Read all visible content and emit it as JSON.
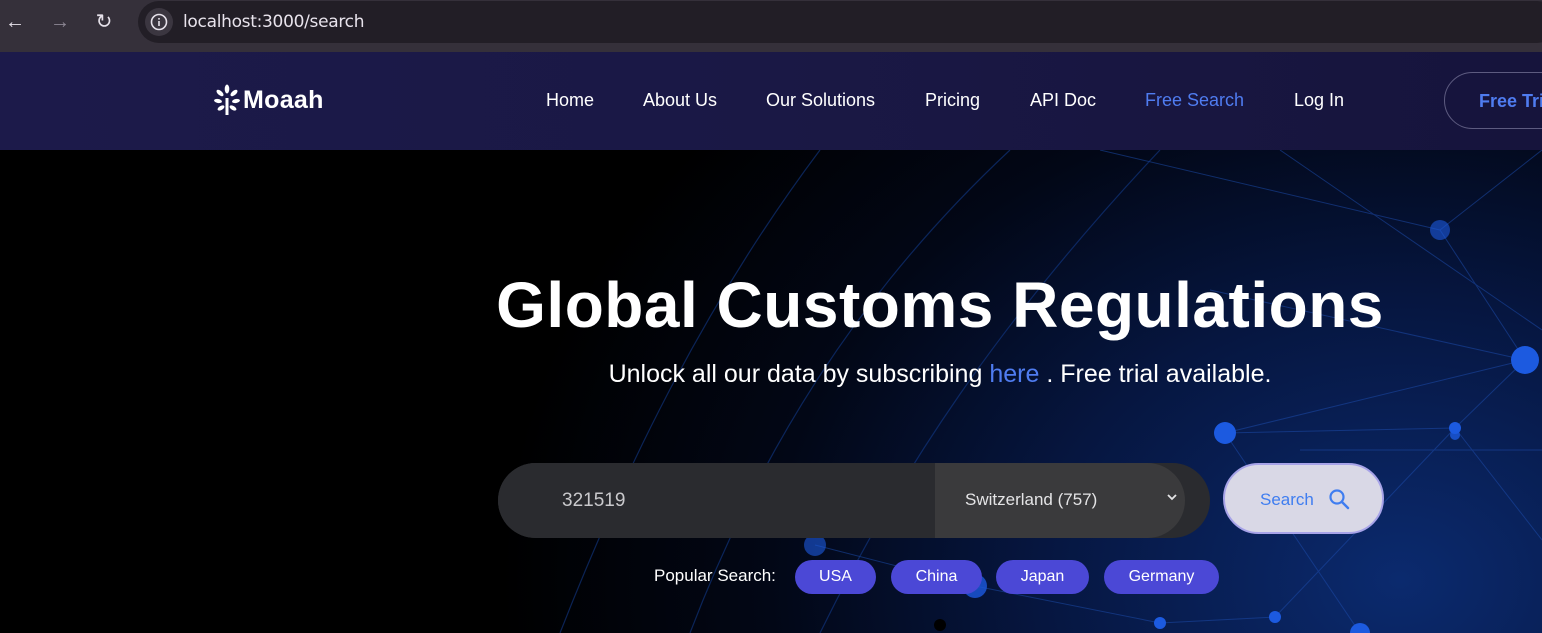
{
  "browser": {
    "url": "localhost:3000/search"
  },
  "header": {
    "brand": "Moaah",
    "nav": [
      "Home",
      "About Us",
      "Our Solutions",
      "Pricing",
      "API Doc",
      "Free Search",
      "Log In"
    ],
    "active_nav": "Free Search",
    "cta_label": "Free Tri"
  },
  "hero": {
    "title": "Global Customs Regulations",
    "subtitle_before": "Unlock all our data by subscribing",
    "subtitle_link": "here",
    "subtitle_after": ". Free trial available."
  },
  "search": {
    "query": "321519",
    "country": "Switzerland (757)",
    "button_label": "Search"
  },
  "popular": {
    "label": "Popular Search:",
    "items": [
      "USA",
      "China",
      "Japan",
      "Germany"
    ]
  },
  "colors": {
    "accent": "#4f7cf0",
    "pill": "#4b48d6",
    "header_bg": "#1c1a4a"
  }
}
